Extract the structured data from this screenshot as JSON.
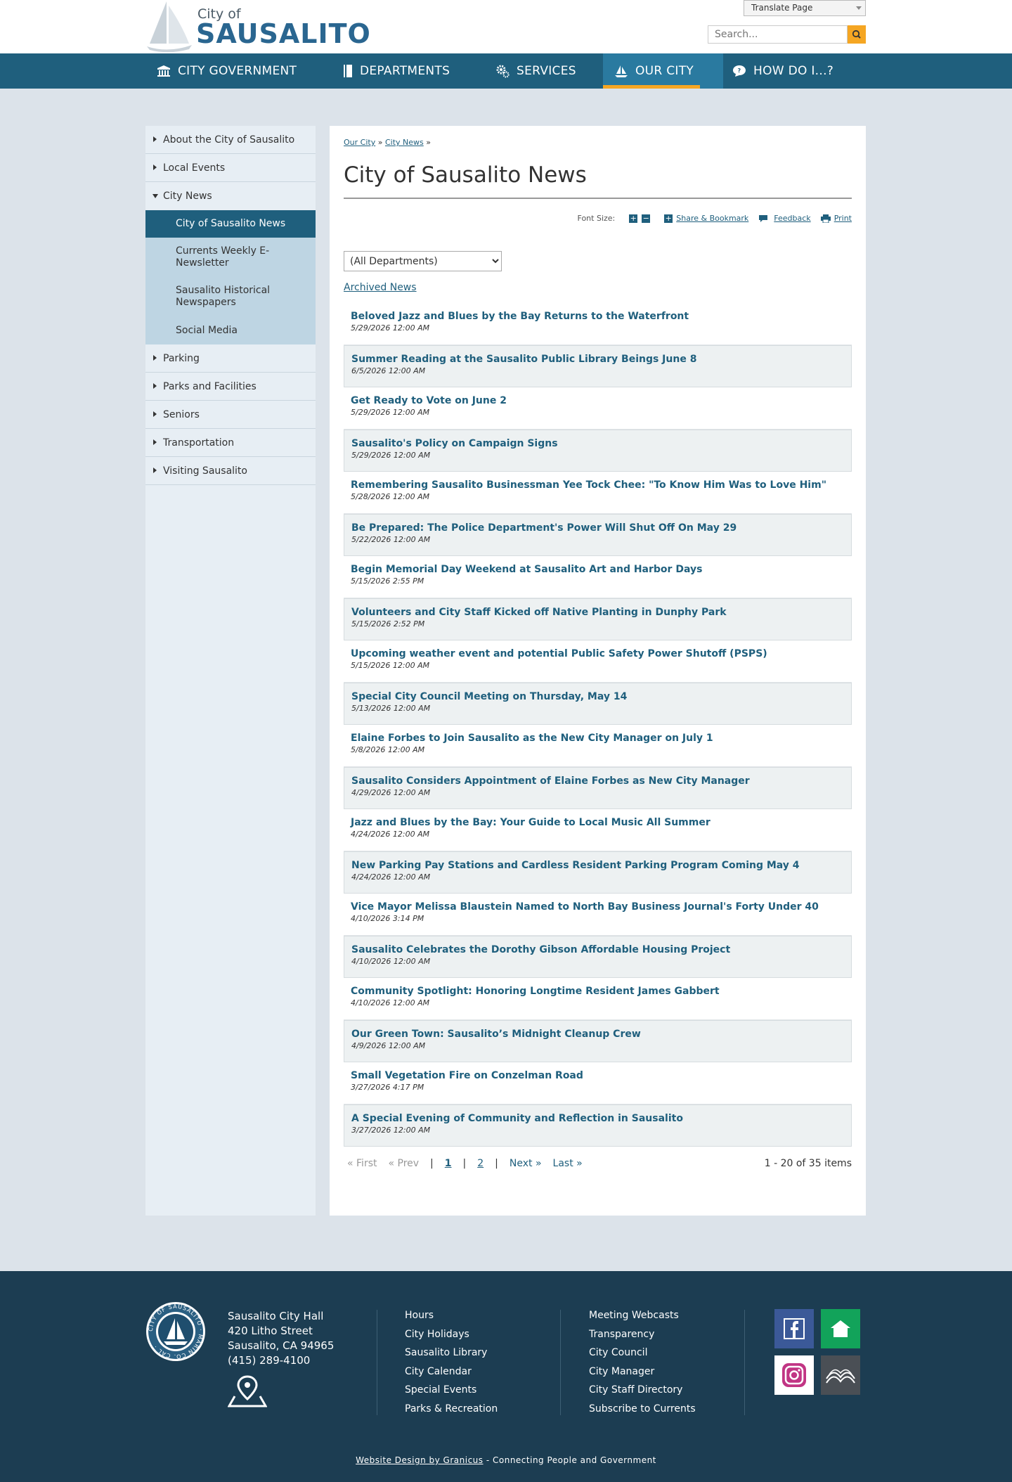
{
  "header": {
    "logo_city_of": "City of",
    "logo_name": "SAUSALITO",
    "translate_label": "Translate Page",
    "search_placeholder": "Search..."
  },
  "nav": [
    {
      "label": "CITY GOVERNMENT",
      "icon": "building-icon"
    },
    {
      "label": "DEPARTMENTS",
      "icon": "book-icon"
    },
    {
      "label": "SERVICES",
      "icon": "gears-icon"
    },
    {
      "label": "OUR CITY",
      "icon": "sailboat-icon",
      "active": true
    },
    {
      "label": "HOW DO I...?",
      "icon": "speech-bubble-icon"
    }
  ],
  "sidebar": {
    "items": [
      {
        "label": "About the City of Sausalito"
      },
      {
        "label": "Local Events"
      },
      {
        "label": "City News"
      },
      {
        "label": "Parking"
      },
      {
        "label": "Parks and Facilities"
      },
      {
        "label": "Seniors"
      },
      {
        "label": "Transportation"
      },
      {
        "label": "Visiting Sausalito"
      }
    ],
    "subitems": [
      {
        "label": "City of Sausalito News",
        "active": true
      },
      {
        "label": "Currents Weekly E-Newsletter"
      },
      {
        "label": "Sausalito Historical Newspapers"
      },
      {
        "label": "Social Media"
      }
    ]
  },
  "breadcrumb": {
    "crumb1": "Our City",
    "crumb2": "City News",
    "sep": "»"
  },
  "page_title": "City of Sausalito News",
  "tools": {
    "font_size_label": "Font Size:",
    "share_label": "Share & Bookmark",
    "feedback_label": "Feedback",
    "print_label": "Print"
  },
  "dept_select": {
    "selected": "(All Departments)"
  },
  "archived_label": "Archived News",
  "news": [
    {
      "title": "Beloved Jazz and Blues by the Bay Returns to the Waterfront",
      "date": "5/29/2026 12:00 AM"
    },
    {
      "title": "Summer Reading at the Sausalito Public Library Beings June 8",
      "date": "6/5/2026 12:00 AM"
    },
    {
      "title": "Get Ready to Vote on June 2",
      "date": "5/29/2026 12:00 AM"
    },
    {
      "title": "Sausalito's Policy on Campaign Signs",
      "date": "5/29/2026 12:00 AM"
    },
    {
      "title": "Remembering Sausalito Businessman Yee Tock Chee: \"To Know Him Was to Love Him\"",
      "date": "5/28/2026 12:00 AM"
    },
    {
      "title": "Be Prepared: The Police Department's Power Will Shut Off On May 29",
      "date": "5/22/2026 12:00 AM"
    },
    {
      "title": "Begin Memorial Day Weekend at Sausalito Art and Harbor Days",
      "date": "5/15/2026 2:55 PM"
    },
    {
      "title": "Volunteers and City Staff Kicked off Native Planting in Dunphy Park",
      "date": "5/15/2026 2:52 PM"
    },
    {
      "title": "Upcoming weather event and potential Public Safety Power Shutoff (PSPS)",
      "date": "5/15/2026 12:00 AM"
    },
    {
      "title": "Special City Council Meeting on Thursday, May 14",
      "date": "5/13/2026 12:00 AM"
    },
    {
      "title": "Elaine Forbes to Join Sausalito as the New City Manager on July 1",
      "date": "5/8/2026 12:00 AM"
    },
    {
      "title": "Sausalito Considers Appointment of Elaine Forbes as New City Manager",
      "date": "4/29/2026 12:00 AM"
    },
    {
      "title": "Jazz and Blues by the Bay: Your Guide to Local Music All Summer",
      "date": "4/24/2026 12:00 AM"
    },
    {
      "title": "New Parking Pay Stations and Cardless Resident Parking Program Coming May 4",
      "date": "4/24/2026 12:00 AM"
    },
    {
      "title": "Vice Mayor Melissa Blaustein Named to North Bay Business Journal's Forty Under 40",
      "date": "4/10/2026 3:14 PM"
    },
    {
      "title": "Sausalito Celebrates the Dorothy Gibson Affordable Housing Project",
      "date": "4/10/2026 12:00 AM"
    },
    {
      "title": "Community Spotlight: Honoring Longtime Resident James Gabbert",
      "date": "4/10/2026 12:00 AM"
    },
    {
      "title": "Our Green Town: Sausalito’s Midnight Cleanup Crew",
      "date": "4/9/2026 12:00 AM"
    },
    {
      "title": "Small Vegetation Fire on Conzelman Road",
      "date": "3/27/2026 4:17 PM"
    },
    {
      "title": "A Special Evening of Community and Reflection in Sausalito",
      "date": "3/27/2026 12:00 AM"
    }
  ],
  "pager": {
    "first": "« First",
    "prev": "« Prev",
    "sep": "|",
    "page1": "1",
    "page2": "2",
    "next": "Next »",
    "last": "Last »",
    "count": "1 - 20 of 35 items"
  },
  "footer": {
    "addr1": "Sausalito City Hall",
    "addr2": "420 Litho Street",
    "addr3": "Sausalito, CA 94965",
    "addr4": "(415) 289-4100",
    "seal_text": "CITY OF SAUSALITO · MARIN CO. CAL ·",
    "col1": [
      "Hours",
      "City Holidays",
      "Sausalito Library",
      "City Calendar",
      "Special Events",
      "Parks & Recreation"
    ],
    "col2": [
      "Meeting Webcasts",
      "Transparency",
      "City Council",
      "City Manager",
      "City Staff Directory",
      "Subscribe to Currents"
    ],
    "credit_link": "Website Design by Granicus",
    "credit_rest": " - Connecting People and Government"
  },
  "colors": {
    "primary": "#1f5f7d",
    "accent": "#f5a623",
    "footer": "#1c3d52"
  }
}
